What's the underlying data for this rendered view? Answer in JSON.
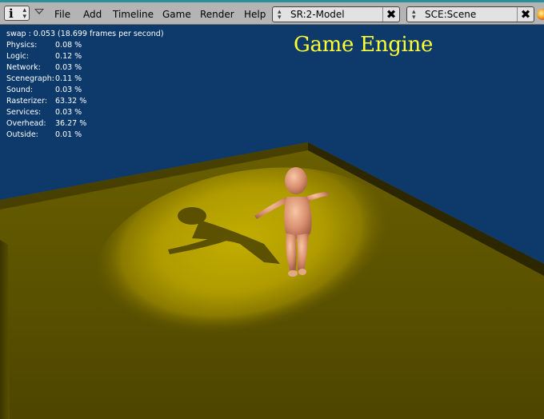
{
  "header": {
    "info_icon": "info-i-icon",
    "menu": [
      "File",
      "Add",
      "Timeline",
      "Game",
      "Render",
      "Help"
    ],
    "screen_select": {
      "value": "SR:2-Model"
    },
    "scene_select": {
      "value": "SCE:Scene"
    },
    "close_glyph": "✖"
  },
  "stats": {
    "swap": "swap : 0.053 (18.699 frames per second)",
    "rows": [
      {
        "label": "Physics:",
        "value": "0.08 %"
      },
      {
        "label": "Logic:",
        "value": "0.12 %"
      },
      {
        "label": "Network:",
        "value": "0.03 %"
      },
      {
        "label": "Scenegraph:",
        "value": "0.11 %"
      },
      {
        "label": "Sound:",
        "value": "0.03 %"
      },
      {
        "label": "Rasterizer:",
        "value": "63.32 %"
      },
      {
        "label": "Services:",
        "value": "0.03 %"
      },
      {
        "label": "Overhead:",
        "value": "36.27 %"
      },
      {
        "label": "Outside:",
        "value": "0.01 %"
      }
    ]
  },
  "viewport": {
    "title": "Game Engine",
    "colors": {
      "background": "#0d3a6b",
      "floor": "#5e5400",
      "spotlight": "#b8a300",
      "title": "#ffff33"
    }
  }
}
